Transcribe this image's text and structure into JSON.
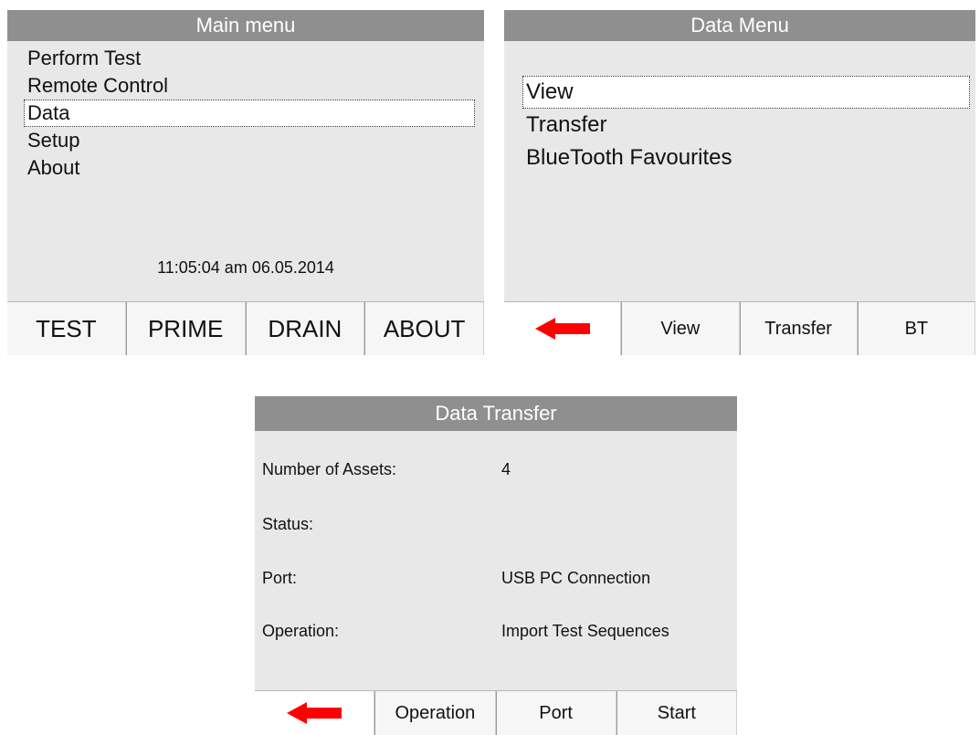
{
  "main_menu": {
    "title": "Main menu",
    "items": [
      {
        "label": "Perform Test",
        "selected": false
      },
      {
        "label": "Remote Control",
        "selected": false
      },
      {
        "label": "Data",
        "selected": true
      },
      {
        "label": "Setup",
        "selected": false
      },
      {
        "label": "About",
        "selected": false
      }
    ],
    "datetime": "11:05:04 am 06.05.2014",
    "softkeys": [
      "TEST",
      "PRIME",
      "DRAIN",
      "ABOUT"
    ]
  },
  "data_menu": {
    "title": "Data Menu",
    "items": [
      {
        "label": "View",
        "selected": true
      },
      {
        "label": "Transfer",
        "selected": false
      },
      {
        "label": "BlueTooth Favourites",
        "selected": false
      }
    ],
    "softkeys": {
      "back_icon": "back-arrow-icon",
      "view": "View",
      "transfer": "Transfer",
      "bt": "BT"
    }
  },
  "data_transfer": {
    "title": "Data Transfer",
    "fields": [
      {
        "label": "Number of Assets:",
        "value": "4"
      },
      {
        "label": "Status:",
        "value": ""
      },
      {
        "label": "Port:",
        "value": "USB PC Connection"
      },
      {
        "label": "Operation:",
        "value": "Import Test Sequences"
      }
    ],
    "softkeys": {
      "back_icon": "back-arrow-icon",
      "operation": "Operation",
      "port": "Port",
      "start": "Start"
    }
  },
  "colors": {
    "titlebar": "#8f8f8f",
    "screen_bg": "#e8e8e8",
    "back_arrow": "#ff0000"
  }
}
